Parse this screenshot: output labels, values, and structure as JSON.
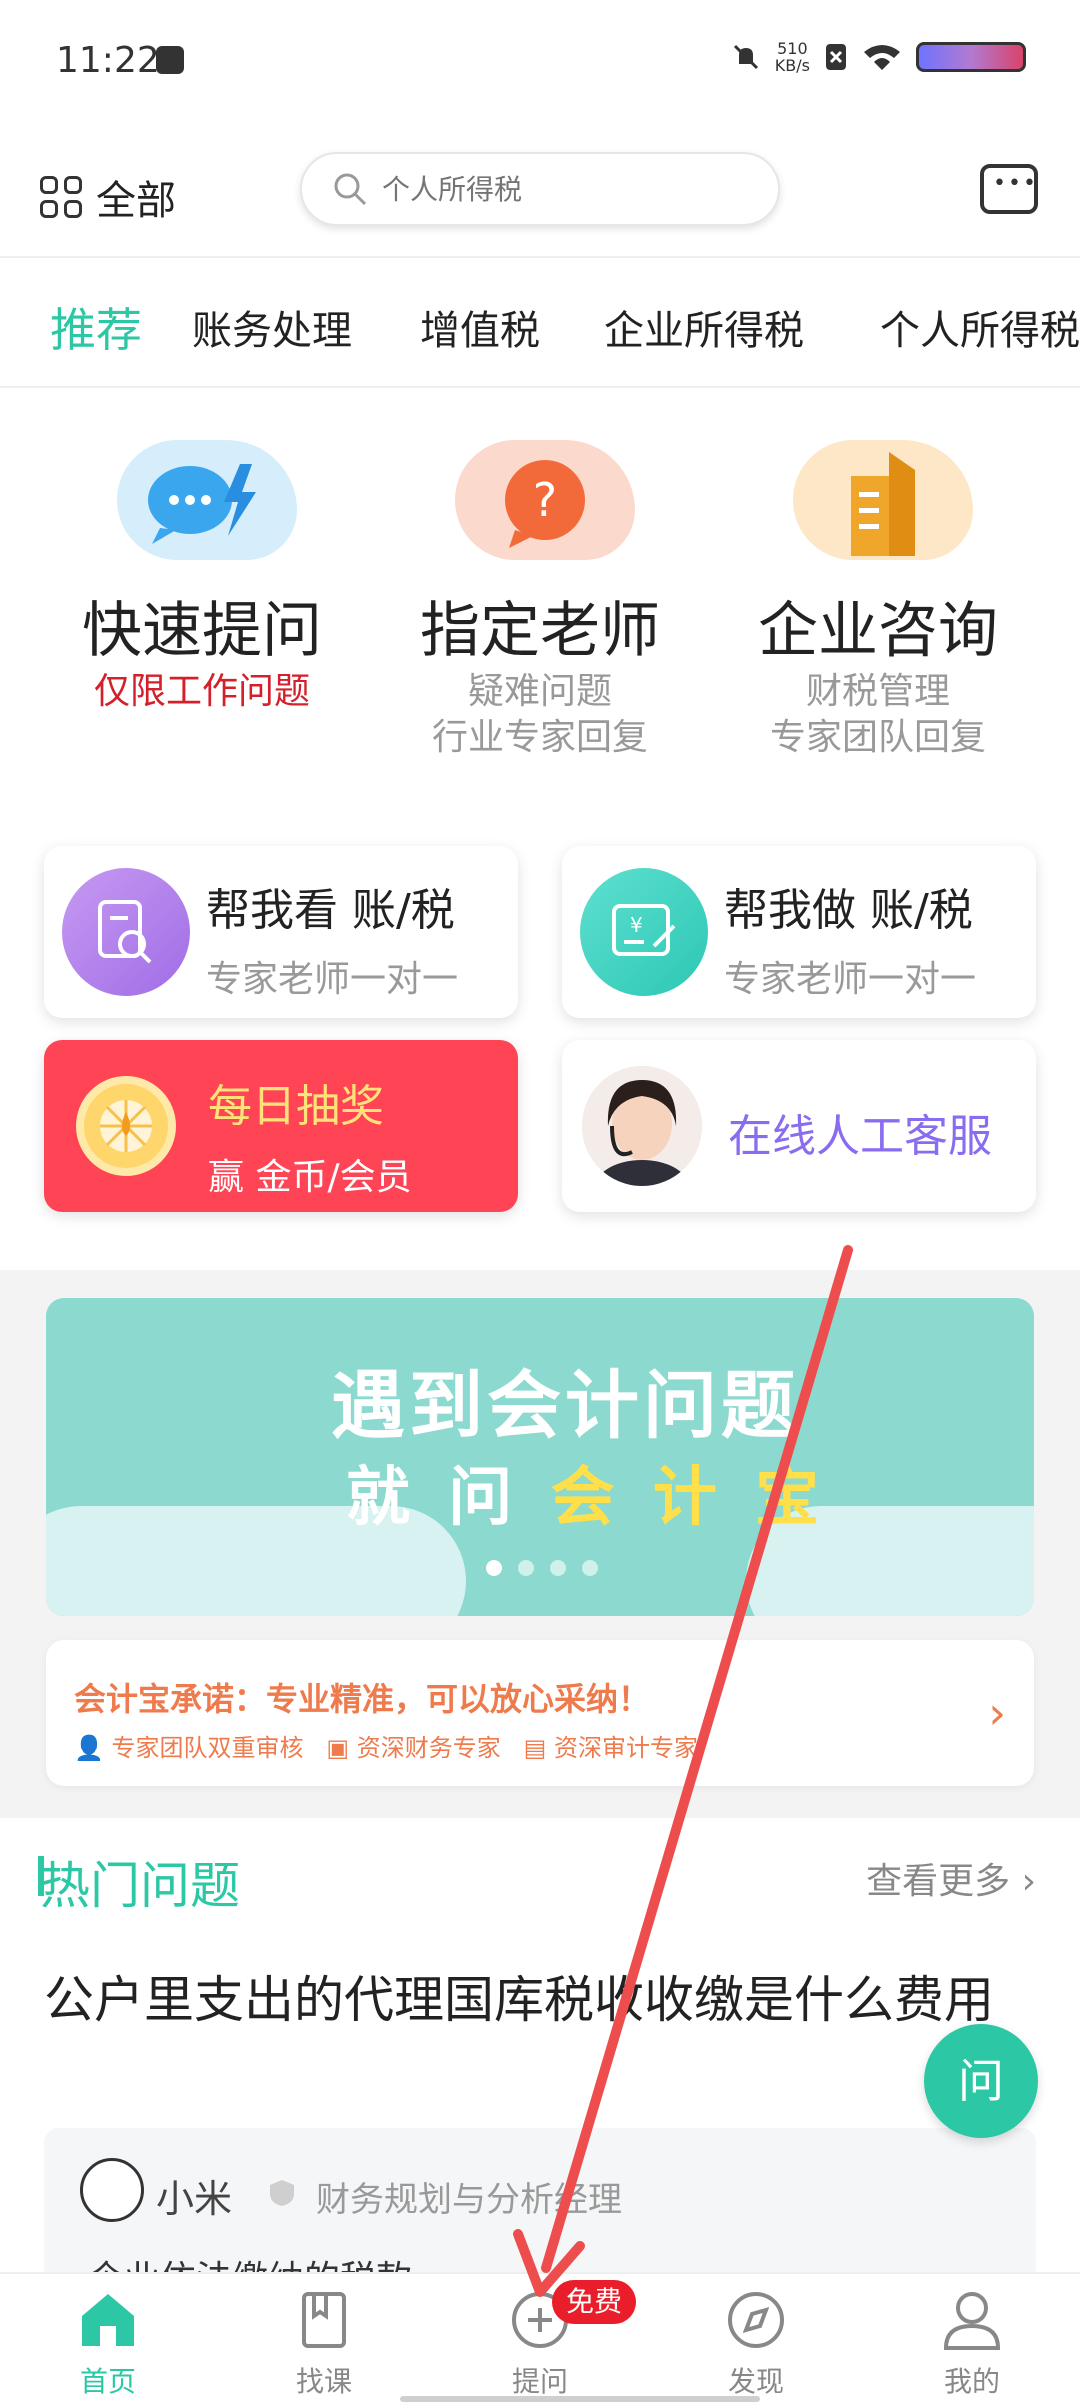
{
  "status_bar": {
    "time": "11:22",
    "speed_value": "510",
    "speed_unit": "KB/s"
  },
  "top_bar": {
    "all_label": "全部",
    "search_placeholder": "个人所得税"
  },
  "tabs": [
    "推荐",
    "账务处理",
    "增值税",
    "企业所得税",
    "个人所得税"
  ],
  "quick_actions": [
    {
      "title": "快速提问",
      "sub1": "仅限工作问题",
      "sub2": ""
    },
    {
      "title": "指定老师",
      "sub1": "疑难问题",
      "sub2": "行业专家回复"
    },
    {
      "title": "企业咨询",
      "sub1": "财税管理",
      "sub2": "专家团队回复"
    }
  ],
  "service_cards": {
    "check": {
      "title": "帮我看 账/税",
      "sub": "专家老师一对一"
    },
    "do": {
      "title": "帮我做 账/税",
      "sub": "专家老师一对一"
    },
    "lottery": {
      "title": "每日抽奖",
      "sub": "赢 金币/会员"
    },
    "support": {
      "title": "在线人工客服"
    }
  },
  "banner": {
    "line1": "遇到会计问题",
    "line2_prefix": "就 问",
    "line2_brand": "会 计 宝"
  },
  "promise": {
    "title": "会计宝承诺：专业精准，可以放心采纳！",
    "items": [
      "专家团队双重审核",
      "资深财务专家",
      "资深审计专家"
    ]
  },
  "hot": {
    "title": "热门问题",
    "more": "查看更多"
  },
  "question": {
    "title": "公户里支出的代理国库税收收缴是什么费用",
    "author": "小米",
    "role": "财务规划与分析经理",
    "answer_preview": "企业依法缴纳的税款"
  },
  "ask_fab": "问",
  "bottom_nav": {
    "items": [
      "首页",
      "找课",
      "提问",
      "发现",
      "我的"
    ],
    "badge": "免费"
  },
  "colors": {
    "accent": "#2cc7a4",
    "danger": "#e91e2a",
    "lottery_bg": "#ff4555"
  }
}
